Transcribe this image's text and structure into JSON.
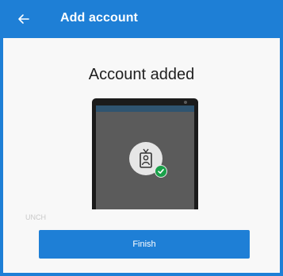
{
  "header": {
    "title": "Add account",
    "back_icon": "back-arrow-icon"
  },
  "main": {
    "heading": "Account added",
    "faint_text": "UNCH",
    "illustration": {
      "icons": [
        "id-badge-icon",
        "checkmark-icon"
      ]
    },
    "finish_label": "Finish"
  },
  "colors": {
    "accent": "#1e7fd6",
    "success": "#1aa14a",
    "content_bg": "#f8f8f8"
  }
}
